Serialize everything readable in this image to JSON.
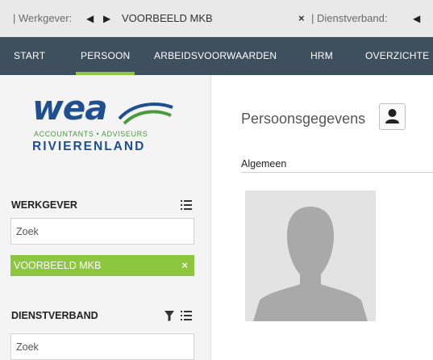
{
  "topbar": {
    "werkgever_label": "| Werkgever:",
    "werkgever_value": "VOORBEELD MKB",
    "close_symbol": "×",
    "dienstverband_label": "| Dienstverband:"
  },
  "nav": {
    "items": [
      "START",
      "PERSOON",
      "ARBEIDSVOORWAARDEN",
      "HRM",
      "OVERZICHTE"
    ],
    "active": "PERSOON"
  },
  "logo": {
    "wea": "wea",
    "tagline": "ACCOUNTANTS • ADVISEURS",
    "region": "RIVIERENLAND"
  },
  "sidebar": {
    "werkgever": {
      "title": "WERKGEVER",
      "search_placeholder": "Zoek",
      "selected": "VOORBEELD MKB",
      "remove_symbol": "×"
    },
    "dienstverband": {
      "title": "DIENSTVERBAND",
      "search_placeholder": "Zoek"
    }
  },
  "main": {
    "title": "Persoonsgegevens",
    "section": "Algemeen"
  },
  "colors": {
    "nav_bg": "#3e4f5e",
    "accent_green": "#8dc63f",
    "logo_blue": "#1d4f91"
  },
  "icons": [
    "left-arrow-icon",
    "right-arrow-icon",
    "close-icon",
    "list-icon",
    "filter-icon",
    "person-icon"
  ]
}
